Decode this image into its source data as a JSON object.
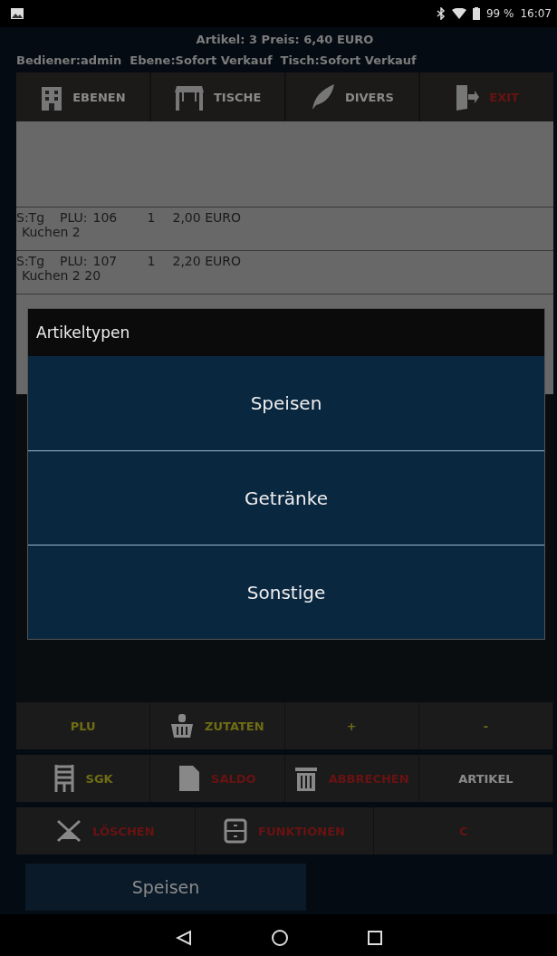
{
  "status_bar": {
    "battery": "99 %",
    "time": "16:07"
  },
  "header": {
    "summary": "Artikel: 3  Preis: 6,40 EURO",
    "operator": "Bediener:admin",
    "level": "Ebene:Sofort Verkauf",
    "table": "Tisch:Sofort Verkauf"
  },
  "toolbar": [
    {
      "label": "EBENEN",
      "kind": "normal"
    },
    {
      "label": "TISCHE",
      "kind": "normal"
    },
    {
      "label": "DIVERS",
      "kind": "normal"
    },
    {
      "label": "EXIT",
      "kind": "danger"
    }
  ],
  "order_rows": [
    {
      "code": "S:Tg",
      "plu": "PLU:",
      "number": "106",
      "qty": "1",
      "price": "2,00 EURO",
      "name": "Kuchen 2"
    },
    {
      "code": "S:Tg",
      "plu": "PLU:",
      "number": "107",
      "qty": "1",
      "price": "2,20 EURO",
      "name": "Kuchen 2 20"
    }
  ],
  "dialog": {
    "title": "Artikeltypen",
    "options": [
      "Speisen",
      "Getränke",
      "Sonstige"
    ]
  },
  "button_rows": [
    [
      {
        "label": "PLU",
        "kind": "yellow"
      },
      {
        "label": "ZUTATEN",
        "kind": "yellow"
      },
      {
        "label": "+",
        "kind": "yellow"
      },
      {
        "label": "-",
        "kind": "yellow"
      }
    ],
    [
      {
        "label": "SGK",
        "kind": "yellow"
      },
      {
        "label": "SALDO",
        "kind": "red"
      },
      {
        "label": "ABBRECHEN",
        "kind": "red"
      },
      {
        "label": "ARTIKEL",
        "kind": "gray"
      }
    ],
    [
      {
        "label": "LÖSCHEN",
        "kind": "red"
      },
      {
        "label": "FUNKTIONEN",
        "kind": "red"
      },
      {
        "label": "C",
        "kind": "red"
      }
    ]
  ],
  "category_tabs": [
    {
      "label": "Speisen",
      "selected": true
    }
  ]
}
